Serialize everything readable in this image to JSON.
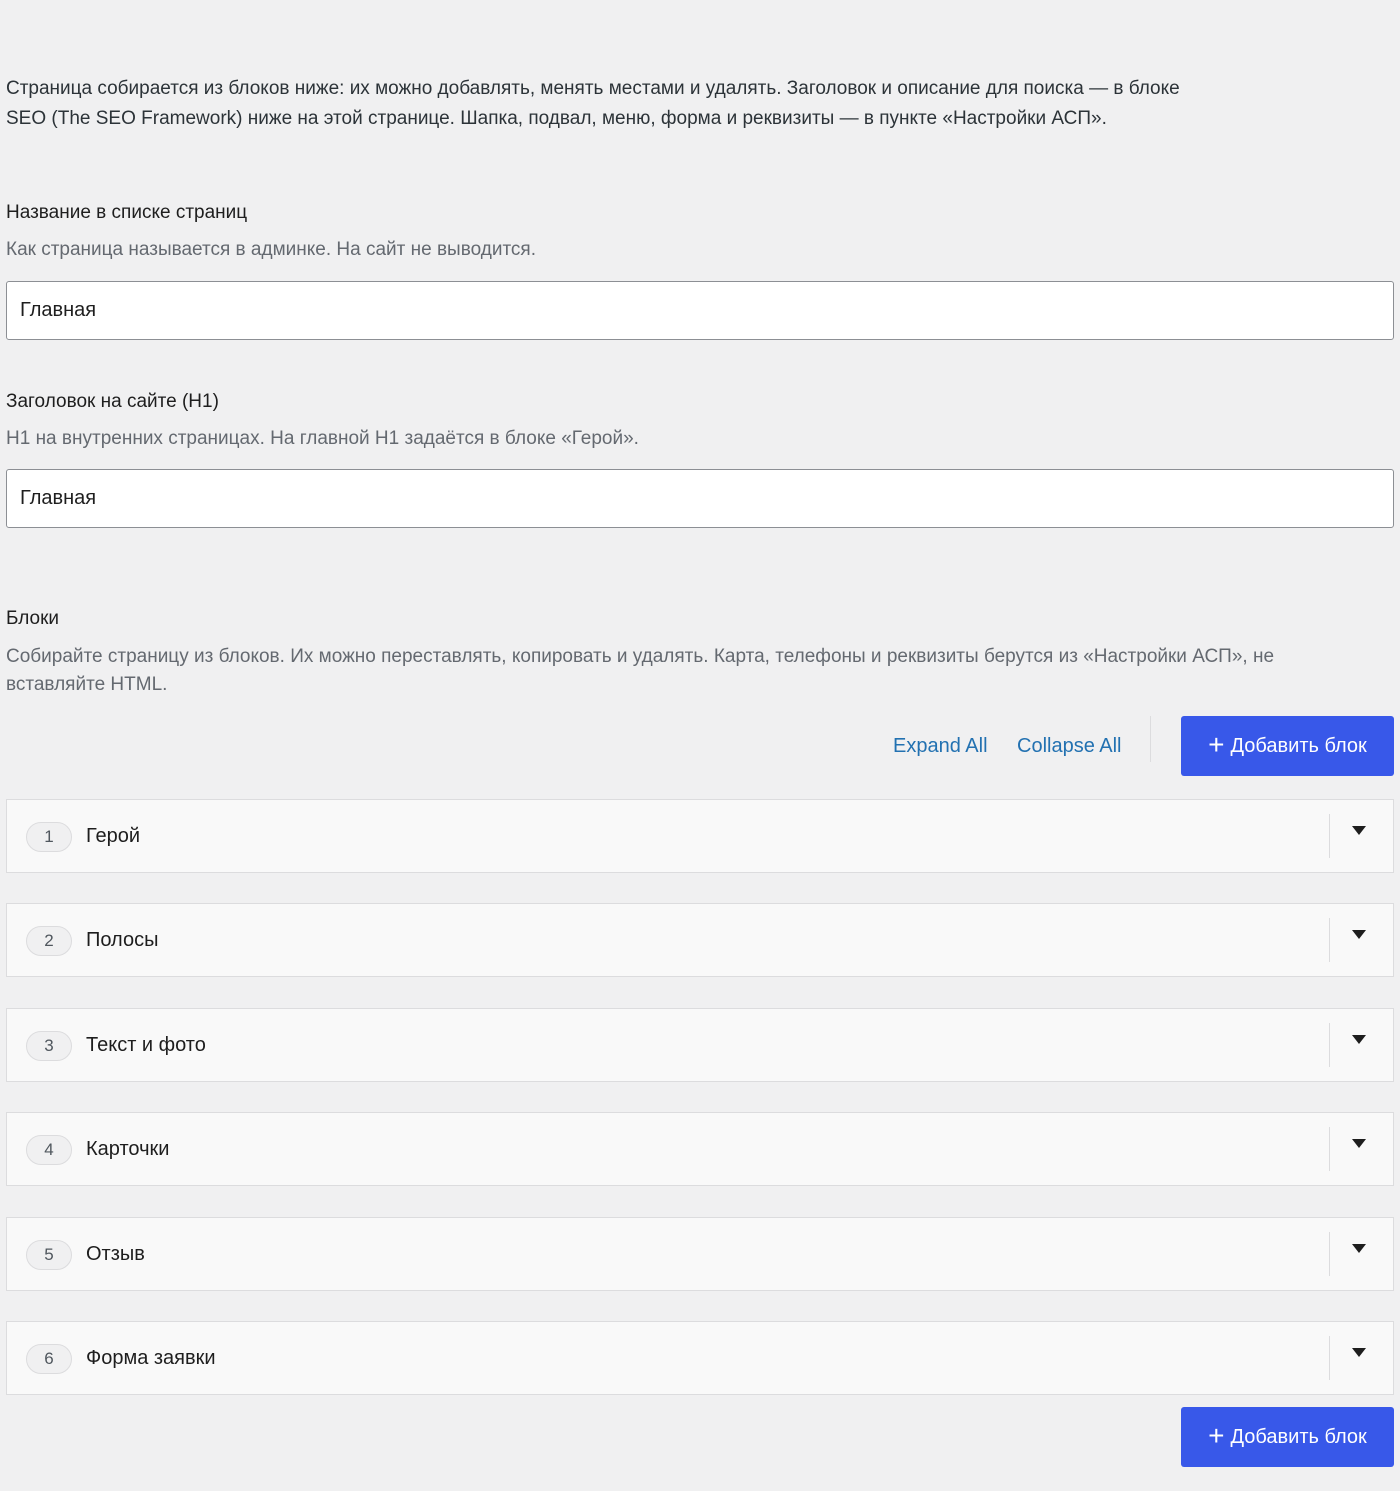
{
  "intro": {
    "text": "Страница собирается из блоков ниже: их можно добавлять, менять местами и удалять. Заголовок и описание для поиска — в блоке SEO (The SEO Framework) ниже на этой странице. Шапка, подвал, меню, форма и реквизиты — в пункте «Настройки АСП»."
  },
  "fields": {
    "list_title": {
      "label": "Название в списке страниц",
      "description": "Как страница называется в админке. На сайт не выводится.",
      "value": "Главная"
    },
    "h1": {
      "label": "Заголовок на сайте (H1)",
      "description": "H1 на внутренних страницах. На главной H1 задаётся в блоке «Герой».",
      "value": "Главная"
    }
  },
  "blocks": {
    "label": "Блоки",
    "description": "Собирайте страницу из блоков. Их можно переставлять, копировать и удалять. Карта, телефоны и реквизиты берутся из «Настройки АСП», не вставляйте HTML.",
    "expand_all": "Expand All",
    "collapse_all": "Collapse All",
    "add_label": "Добавить блок",
    "add_icon": "+",
    "items": [
      {
        "num": "1",
        "title": "Герой"
      },
      {
        "num": "2",
        "title": "Полосы"
      },
      {
        "num": "3",
        "title": "Текст и фото"
      },
      {
        "num": "4",
        "title": "Карточки"
      },
      {
        "num": "5",
        "title": "Отзыв"
      },
      {
        "num": "6",
        "title": "Форма заявки"
      }
    ]
  },
  "colors": {
    "accent": "#3858e9",
    "link": "#2271b1",
    "background": "#f0f0f1"
  },
  "icons": {
    "block_toggle": "caret-down-icon",
    "add": "plus-icon"
  }
}
